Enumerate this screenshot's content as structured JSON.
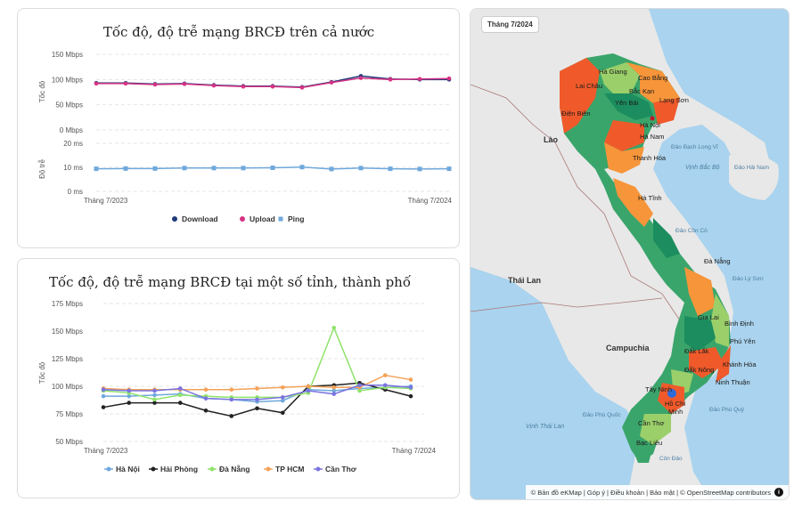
{
  "charts": {
    "top": {
      "title": "Tốc độ, độ trễ mạng BRCĐ trên cả nước",
      "speed_axis_title": "Tốc độ",
      "latency_axis_title": "Độ trễ",
      "speed_ticks": [
        "150 Mbps",
        "100 Mbps",
        "50 Mbps",
        "0 Mbps"
      ],
      "latency_ticks": [
        "20 ms",
        "10 ms",
        "0 ms"
      ],
      "x_start": "Tháng 7/2023",
      "x_end": "Tháng 7/2024",
      "legend": [
        "Download",
        "Upload",
        "Ping"
      ]
    },
    "bottom": {
      "title": "Tốc độ, độ trễ mạng BRCĐ tại một số tỉnh, thành phố",
      "axis_title": "Tốc độ",
      "ticks": [
        "175 Mbps",
        "150 Mbps",
        "125 Mbps",
        "100 Mbps",
        "75 Mbps",
        "50 Mbps"
      ],
      "x_start": "Tháng 7/2023",
      "x_end": "Tháng 7/2024",
      "legend": [
        "Hà Nội",
        "Hải Phòng",
        "Đà Nẵng",
        "TP HCM",
        "Cần Thơ"
      ]
    }
  },
  "chart_data": [
    {
      "type": "line",
      "title": "Tốc độ, độ trễ mạng BRCĐ trên cả nước",
      "x": [
        "Tháng 7/2023",
        "",
        "",
        "",
        "",
        "",
        "",
        "",
        "",
        "",
        "",
        "",
        "Tháng 7/2024"
      ],
      "series": [
        {
          "name": "Download",
          "axis": "Mbps",
          "color": "#1f3b7a",
          "values": [
            93,
            93,
            91,
            92,
            89,
            87,
            87,
            85,
            95,
            107,
            101,
            100,
            100
          ]
        },
        {
          "name": "Upload",
          "axis": "Mbps",
          "color": "#d63384",
          "values": [
            92,
            92,
            90,
            91,
            88,
            86,
            86,
            84,
            94,
            103,
            100,
            101,
            102
          ]
        },
        {
          "name": "Ping",
          "axis": "ms",
          "color": "#6fa8dc",
          "values": [
            9.4,
            9.5,
            9.5,
            9.7,
            9.7,
            9.7,
            9.8,
            10.1,
            9.3,
            9.7,
            9.4,
            9.3,
            9.4
          ]
        }
      ],
      "ylim_speed": [
        0,
        150
      ],
      "ylim_latency": [
        0,
        20
      ]
    },
    {
      "type": "line",
      "title": "Tốc độ, độ trễ mạng BRCĐ tại một số tỉnh, thành phố",
      "x": [
        "Tháng 7/2023",
        "",
        "",
        "",
        "",
        "",
        "",
        "",
        "",
        "",
        "",
        "",
        "Tháng 7/2024"
      ],
      "series": [
        {
          "name": "Hà Nội",
          "color": "#6fa8dc",
          "values": [
            91,
            91,
            92,
            93,
            89,
            88,
            86,
            87,
            97,
            96,
            98,
            99,
            100
          ]
        },
        {
          "name": "Hải Phòng",
          "color": "#222222",
          "values": [
            81,
            85,
            85,
            85,
            78,
            73,
            80,
            76,
            100,
            101,
            103,
            97,
            91
          ]
        },
        {
          "name": "Đà Nẵng",
          "color": "#8fe36b",
          "values": [
            96,
            94,
            88,
            92,
            91,
            90,
            90,
            90,
            94,
            153,
            96,
            99,
            98
          ]
        },
        {
          "name": "TP HCM",
          "color": "#f4a259",
          "values": [
            98,
            97,
            97,
            97,
            97,
            97,
            98,
            99,
            100,
            99,
            99,
            110,
            106
          ]
        },
        {
          "name": "Cần Thơ",
          "color": "#7b74e0",
          "values": [
            97,
            96,
            96,
            98,
            89,
            88,
            88,
            90,
            96,
            93,
            101,
            101,
            99
          ]
        }
      ],
      "ylim": [
        50,
        175
      ]
    }
  ],
  "map": {
    "badge": "Tháng 7/2024",
    "attribution": "© Bản đồ eKMap | Góp ý | Điều khoản | Bảo mật | © OpenStreetMap contributors",
    "info_glyph": "i",
    "labels": {
      "lao": "Lào",
      "thailand": "Thái Lan",
      "cambodia": "Campuchia",
      "gulf_tonkin": "Vịnh Bắc Bộ",
      "gulf_thai": "Vịnh Thái Lan",
      "hai_nam": "Đảo Hải Nam",
      "bach_long_vi": "Đảo Bạch Long Vĩ",
      "con_co": "Đảo Cồn Cỏ",
      "ly_son": "Đảo Lý Sơn",
      "phu_quy": "Đảo Phú Quý",
      "phu_quoc": "Đảo Phú Quốc",
      "con_dao": "Côn Đảo",
      "ha_giang": "Hà Giang",
      "cao_bang": "Cao Bằng",
      "lai_chau": "Lai Châu",
      "bac_kan": "Bắc Kạn",
      "yen_bai": "Yên Bái",
      "lang_son": "Lạng Sơn",
      "dien_bien": "Điện Biên",
      "ha_noi": "Hà Nội",
      "ha_nam": "Hà Nam",
      "thanh_hoa": "Thanh Hóa",
      "ha_tinh": "Hà Tĩnh",
      "da_nang": "Đà Nẵng",
      "gia_lai": "Gia Lai",
      "binh_dinh": "Bình Định",
      "phu_yen": "Phú Yên",
      "dak_lak": "Đắk Lắk",
      "khanh_hoa": "Khánh Hòa",
      "dak_nong": "Đắk Nông",
      "ninh_thuan": "Ninh Thuận",
      "tay_ninh": "Tây Ninh",
      "hcm1": "Hồ Chí",
      "hcm2": "Minh",
      "can_tho": "Cần Thơ",
      "bac_lieu": "Bạc Liêu"
    }
  }
}
